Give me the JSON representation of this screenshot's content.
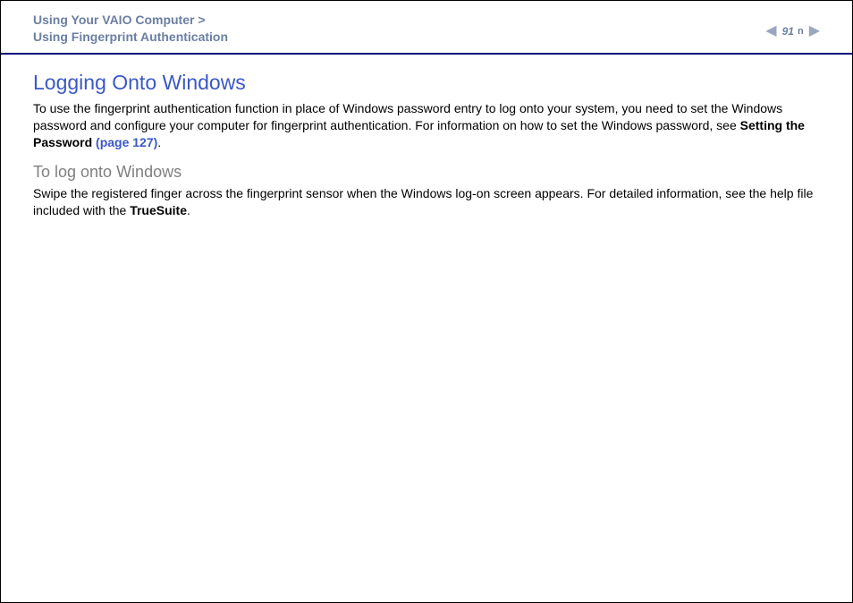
{
  "header": {
    "breadcrumb_line1": "Using Your VAIO Computer >",
    "breadcrumb_line2": "Using Fingerprint Authentication",
    "page_number": "91",
    "n_marker": "n"
  },
  "content": {
    "title": "Logging Onto Windows",
    "para1_a": "To use the fingerprint authentication function in place of Windows password entry to log onto your system, you need to set the Windows password and configure your computer for fingerprint authentication. For information on how to set the Windows password, see ",
    "para1_bold": "Setting the Password ",
    "para1_link": "(page 127)",
    "para1_end": ".",
    "subtitle": "To log onto Windows",
    "para2_a": "Swipe the registered finger across the fingerprint sensor when the Windows log-on screen appears. For detailed information, see the help file included with the ",
    "para2_bold": "TrueSuite",
    "para2_end": "."
  }
}
